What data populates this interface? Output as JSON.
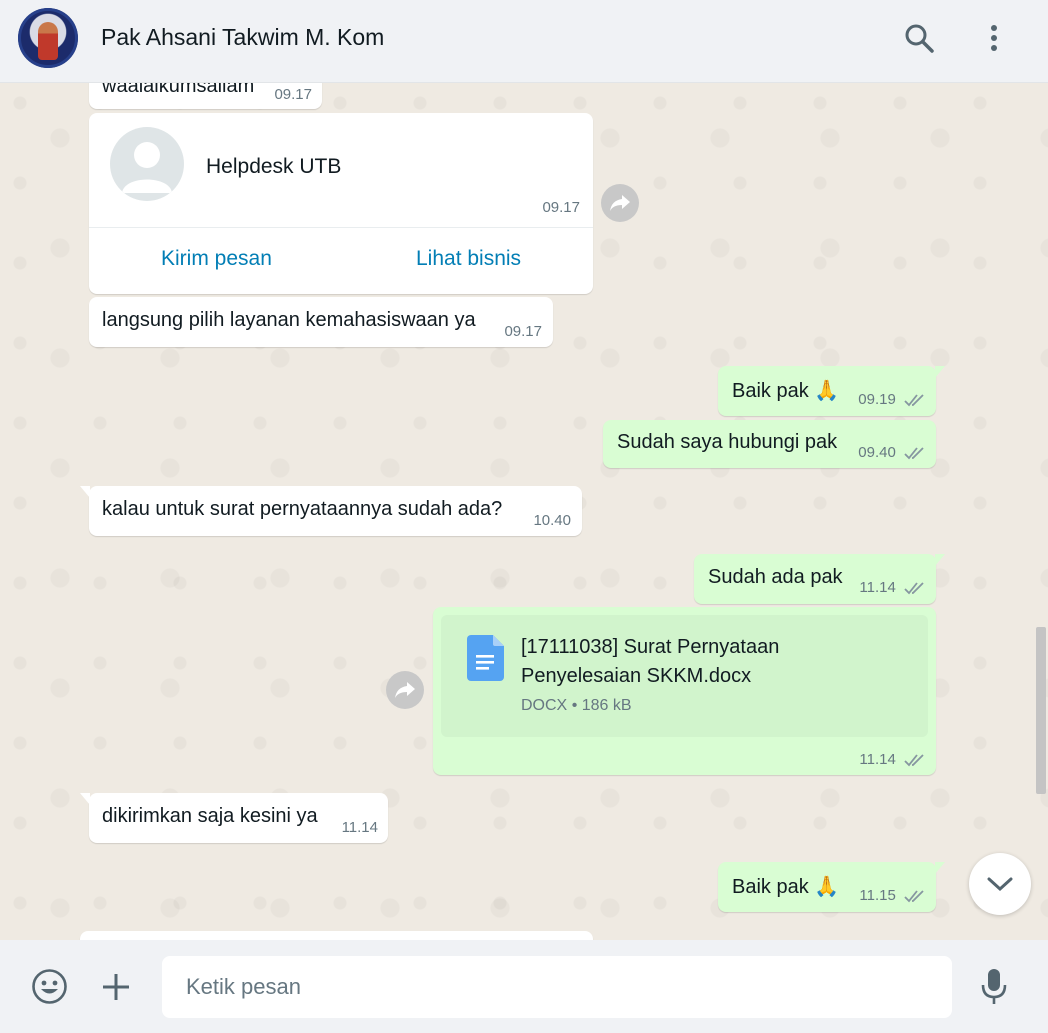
{
  "header": {
    "contact_name": "Pak Ahsani Takwim M. Kom",
    "icons": [
      "search-icon",
      "menu-dots-icon"
    ]
  },
  "messages": [
    {
      "id": "m0",
      "direction": "in",
      "text": "waalaikumsallam",
      "time": "09.17"
    },
    {
      "id": "m1",
      "direction": "in",
      "type": "contact",
      "contact_name": "Helpdesk UTB",
      "time": "09.17",
      "actions": [
        "Kirim pesan",
        "Lihat bisnis"
      ]
    },
    {
      "id": "m2",
      "direction": "in",
      "text": "langsung pilih layanan kemahasiswaan ya",
      "time": "09.17"
    },
    {
      "id": "m3",
      "direction": "out",
      "text": "Baik pak",
      "emoji": "🙏",
      "time": "09.19",
      "status": "read"
    },
    {
      "id": "m4",
      "direction": "out",
      "text": "Sudah saya hubungi pak",
      "time": "09.40",
      "status": "read"
    },
    {
      "id": "m5",
      "direction": "in",
      "text": "kalau untuk surat pernyataannya sudah ada?",
      "time": "10.40"
    },
    {
      "id": "m6",
      "direction": "out",
      "text": "Sudah ada pak",
      "time": "11.14",
      "status": "read"
    },
    {
      "id": "m7",
      "direction": "out",
      "type": "document",
      "file_name": "[17111038] Surat Pernyataan Penyelesaian SKKM.docx",
      "file_type": "DOCX",
      "file_size": "186 kB",
      "time": "11.14",
      "status": "read"
    },
    {
      "id": "m8",
      "direction": "in",
      "text": "dikirimkan saja kesini ya",
      "time": "11.14"
    },
    {
      "id": "m9",
      "direction": "out",
      "text": "Baik pak",
      "emoji": "🙏",
      "time": "11.15",
      "status": "read"
    }
  ],
  "composer": {
    "placeholder": "Ketik pesan",
    "icons": [
      "emoji-icon",
      "plus-icon",
      "microphone-icon"
    ]
  },
  "colors": {
    "incoming_bubble": "#ffffff",
    "outgoing_bubble": "#d9fdd3",
    "link": "#027eb5",
    "read_ticks": "#8696a0",
    "chat_background": "#efeae2"
  }
}
